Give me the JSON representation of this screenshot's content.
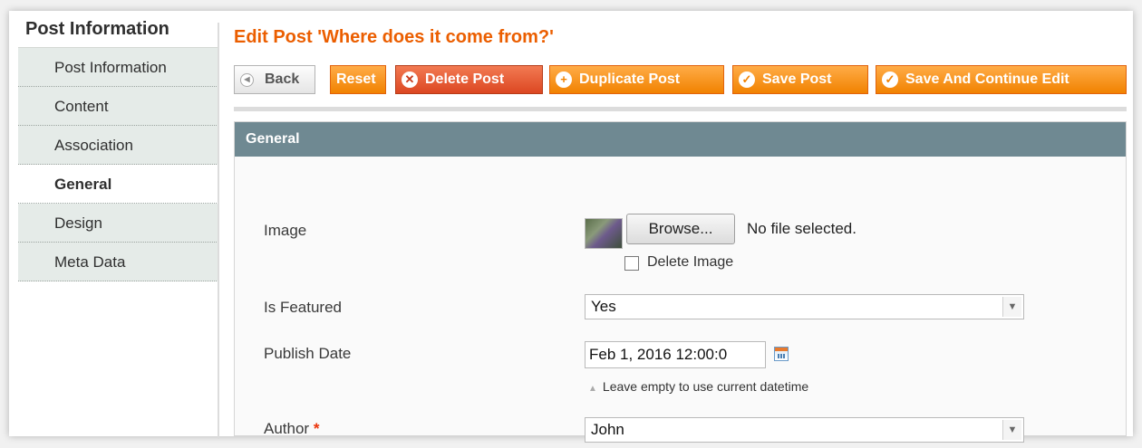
{
  "sidebar": {
    "title": "Post Information",
    "items": [
      {
        "label": "Post Information"
      },
      {
        "label": "Content"
      },
      {
        "label": "Association"
      },
      {
        "label": "General"
      },
      {
        "label": "Design"
      },
      {
        "label": "Meta Data"
      }
    ],
    "active_index": 3
  },
  "page": {
    "title": "Edit Post 'Where does it come from?'"
  },
  "toolbar": {
    "back_label": "Back",
    "reset_label": "Reset",
    "delete_label": "Delete Post",
    "duplicate_label": "Duplicate Post",
    "save_label": "Save Post",
    "save_continue_label": "Save And Continue Edit"
  },
  "fieldset": {
    "title": "General",
    "image": {
      "label": "Image",
      "browse_label": "Browse...",
      "file_status": "No file selected.",
      "delete_label": "Delete Image",
      "delete_checked": false
    },
    "is_featured": {
      "label": "Is Featured",
      "value": "Yes"
    },
    "publish_date": {
      "label": "Publish Date",
      "value": "Feb 1, 2016 12:00:0",
      "hint": "Leave empty to use current datetime"
    },
    "author": {
      "label": "Author",
      "required_mark": "*",
      "value": "John"
    }
  },
  "colors": {
    "accent": "#eb5e00",
    "button_orange": "#f18200",
    "button_delete": "#dc4722",
    "fieldset_header": "#6f8992",
    "sidebar_bg": "#e5ebe8"
  },
  "icons": {
    "back": "arrow-left-icon",
    "delete": "x-circle-icon",
    "duplicate": "plus-circle-icon",
    "save": "checkmark-icon",
    "calendar": "calendar-icon",
    "dropdown": "chevron-down-icon"
  }
}
